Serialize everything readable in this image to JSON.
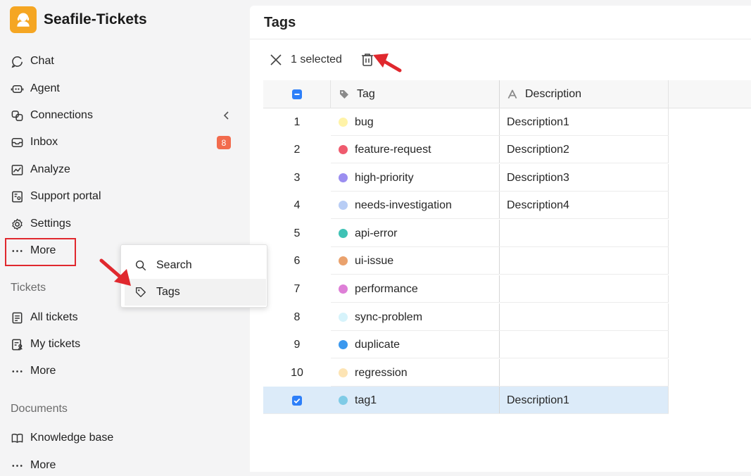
{
  "app": {
    "title": "Seafile-Tickets",
    "accent": "#f5a623"
  },
  "sidebar": {
    "items": [
      {
        "label": "Chat",
        "icon": "chat-icon"
      },
      {
        "label": "Agent",
        "icon": "agent-icon"
      },
      {
        "label": "Connections",
        "icon": "connections-icon"
      },
      {
        "label": "Inbox",
        "icon": "inbox-icon",
        "badge": "8"
      },
      {
        "label": "Analyze",
        "icon": "analyze-icon"
      },
      {
        "label": "Support portal",
        "icon": "portal-icon"
      },
      {
        "label": "Settings",
        "icon": "gear-icon"
      },
      {
        "label": "More",
        "icon": "more-icon"
      }
    ],
    "tickets_section": {
      "label": "Tickets",
      "items": [
        {
          "label": "All tickets",
          "icon": "list-icon"
        },
        {
          "label": "My tickets",
          "icon": "my-tickets-icon"
        },
        {
          "label": "More",
          "icon": "more-icon"
        }
      ]
    },
    "documents_section": {
      "label": "Documents",
      "items": [
        {
          "label": "Knowledge base",
          "icon": "book-icon"
        },
        {
          "label": "More",
          "icon": "more-icon"
        }
      ]
    }
  },
  "menu": {
    "items": [
      {
        "label": "Search",
        "icon": "search-icon"
      },
      {
        "label": "Tags",
        "icon": "tag-icon"
      }
    ]
  },
  "main": {
    "title": "Tags",
    "toolbar": {
      "selected_text": "1 selected"
    },
    "table": {
      "columns": [
        "Tag",
        "Description"
      ],
      "rows": [
        {
          "index": "1",
          "tag": "bug",
          "color": "#fff3a8",
          "description": "Description1"
        },
        {
          "index": "2",
          "tag": "feature-request",
          "color": "#ef5b6e",
          "description": "Description2"
        },
        {
          "index": "3",
          "tag": "high-priority",
          "color": "#9b8ef0",
          "description": "Description3"
        },
        {
          "index": "4",
          "tag": "needs-investigation",
          "color": "#b8cdf5",
          "description": "Description4"
        },
        {
          "index": "5",
          "tag": "api-error",
          "color": "#3fc2b5",
          "description": ""
        },
        {
          "index": "6",
          "tag": "ui-issue",
          "color": "#eaa26d",
          "description": ""
        },
        {
          "index": "7",
          "tag": "performance",
          "color": "#de7fd7",
          "description": ""
        },
        {
          "index": "8",
          "tag": "sync-problem",
          "color": "#d6f3fb",
          "description": ""
        },
        {
          "index": "9",
          "tag": "duplicate",
          "color": "#3b98ee",
          "description": ""
        },
        {
          "index": "10",
          "tag": "regression",
          "color": "#fde4b4",
          "description": ""
        },
        {
          "index": "",
          "tag": "tag1",
          "color": "#7fcbe6",
          "description": "Description1",
          "selected": true
        }
      ]
    }
  }
}
